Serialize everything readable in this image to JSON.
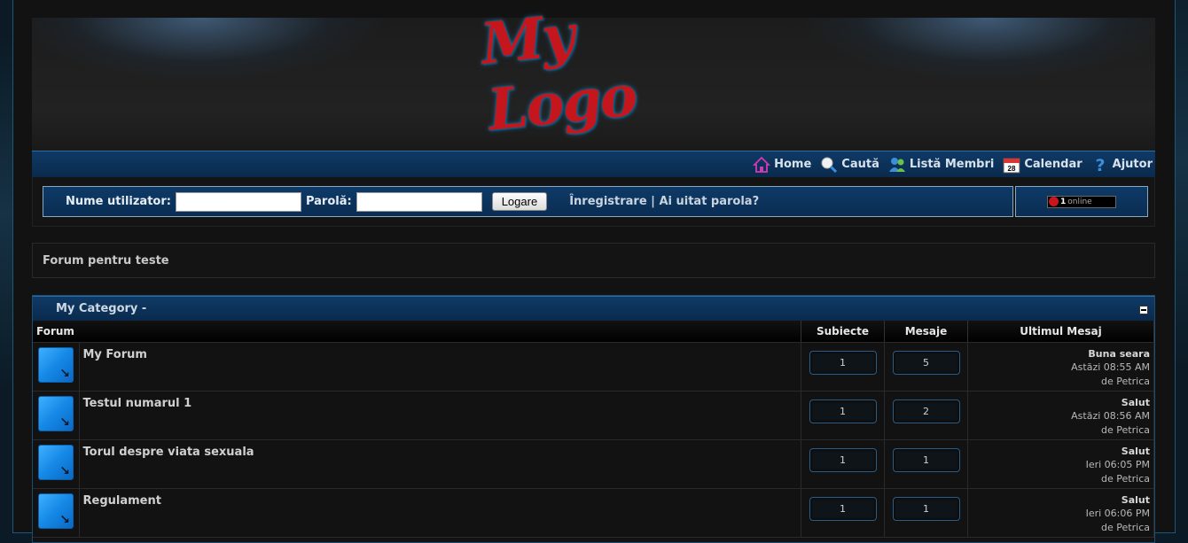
{
  "logo": {
    "text": "My Logo"
  },
  "nav": {
    "items": [
      {
        "label": "Home",
        "icon": "home-icon"
      },
      {
        "label": "Caută",
        "icon": "search-icon"
      },
      {
        "label": "Listă Membri",
        "icon": "members-icon"
      },
      {
        "label": "Calendar",
        "icon": "calendar-icon"
      },
      {
        "label": "Ajutor",
        "icon": "help-icon"
      }
    ]
  },
  "login": {
    "username_label": "Nume utilizator:",
    "password_label": "Parolă:",
    "submit_label": "Logare",
    "register_link": "Înregistrare",
    "separator": "|",
    "forgot_link": "Ai uitat parola?",
    "username_value": "",
    "password_value": ""
  },
  "online": {
    "count": "1",
    "text": "online"
  },
  "description": "Forum pentru teste",
  "category": {
    "title": "My Category -",
    "columns": {
      "forum": "Forum",
      "topics": "Subiecte",
      "posts": "Mesaje",
      "last": "Ultimul Mesaj"
    },
    "forums": [
      {
        "name": "My Forum",
        "topics": "1",
        "posts": "5",
        "last_title": "Buna seara",
        "last_date": "Astăzi 08:55 AM",
        "last_by_prefix": "de",
        "last_author": "Petrica"
      },
      {
        "name": "Testul numarul 1",
        "topics": "1",
        "posts": "2",
        "last_title": "Salut",
        "last_date": "Astăzi 08:56 AM",
        "last_by_prefix": "de",
        "last_author": "Petrica"
      },
      {
        "name": "Torul despre viata sexuala",
        "topics": "1",
        "posts": "1",
        "last_title": "Salut",
        "last_date": "Ieri 06:05 PM",
        "last_by_prefix": "de",
        "last_author": "Petrica"
      },
      {
        "name": "Regulament",
        "topics": "1",
        "posts": "1",
        "last_title": "Salut",
        "last_date": "Ieri 06:06 PM",
        "last_by_prefix": "de",
        "last_author": "Petrica"
      }
    ]
  },
  "colors": {
    "accent": "#0f3a66",
    "logo": "#c4161c",
    "forum_icon": "#1588e6"
  }
}
